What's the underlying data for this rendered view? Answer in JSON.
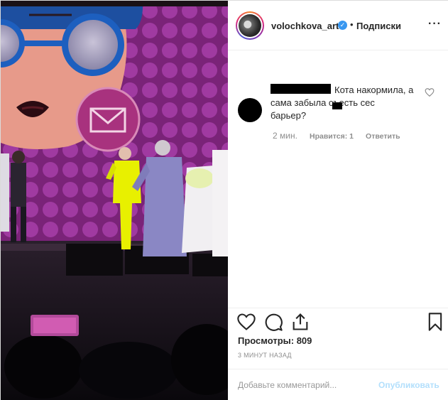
{
  "header": {
    "username": "volochkova_art",
    "separator": "•",
    "follow_label": "Подписки",
    "more_label": "···"
  },
  "comment": {
    "text_line1": "Кота накормила, а",
    "text_line2": "сама забыла съесть се",
    "text_line2_end": "с",
    "text_line3": "барьер?",
    "time": "2 мин.",
    "likes": "Нравится: 1",
    "reply": "Ответить"
  },
  "post": {
    "views": "Просмотры: 809",
    "posted": "3 МИНУТ НАЗАД"
  },
  "add_comment": {
    "placeholder": "Добавьте комментарий...",
    "publish_label": "Опубликовать"
  },
  "colors": {
    "accent_blue": "#3897f0",
    "publish_disabled": "#b2dffc",
    "stage_purple": "#8f2c8e",
    "performer_yellow": "#e8f000"
  },
  "icons": [
    "heart-icon",
    "comment-icon",
    "share-icon",
    "bookmark-icon",
    "envelope-icon",
    "verified-badge-icon",
    "more-options-icon"
  ]
}
